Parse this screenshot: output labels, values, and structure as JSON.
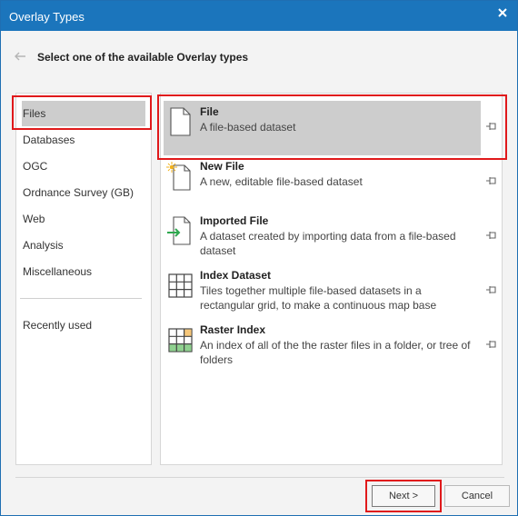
{
  "window": {
    "title": "Overlay Types"
  },
  "header": {
    "heading": "Select one of the available Overlay types"
  },
  "categories": [
    {
      "label": "Files",
      "selected": true
    },
    {
      "label": "Databases"
    },
    {
      "label": "OGC"
    },
    {
      "label": "Ordnance Survey (GB)"
    },
    {
      "label": "Web"
    },
    {
      "label": "Analysis"
    },
    {
      "label": "Miscellaneous"
    }
  ],
  "recent": {
    "label": "Recently used"
  },
  "items": [
    {
      "name": "File",
      "description": "A file-based dataset",
      "icon": "file-icon",
      "selected": true
    },
    {
      "name": "New File",
      "description": "A new, editable file-based dataset",
      "icon": "new-file-icon"
    },
    {
      "name": "Imported File",
      "description": "A dataset created by importing data from a file-based dataset",
      "icon": "import-file-icon"
    },
    {
      "name": "Index Dataset",
      "description": "Tiles together multiple file-based datasets in a rectangular grid, to make a continuous map base",
      "icon": "grid-icon"
    },
    {
      "name": "Raster Index",
      "description": "An index of all of the the raster files in a folder, or tree of folders",
      "icon": "raster-grid-icon"
    }
  ],
  "buttons": {
    "next": "Next >",
    "cancel": "Cancel"
  },
  "colors": {
    "titlebar": "#1b75bc",
    "highlight": "#e0191b",
    "selection": "#cdcdcd"
  }
}
